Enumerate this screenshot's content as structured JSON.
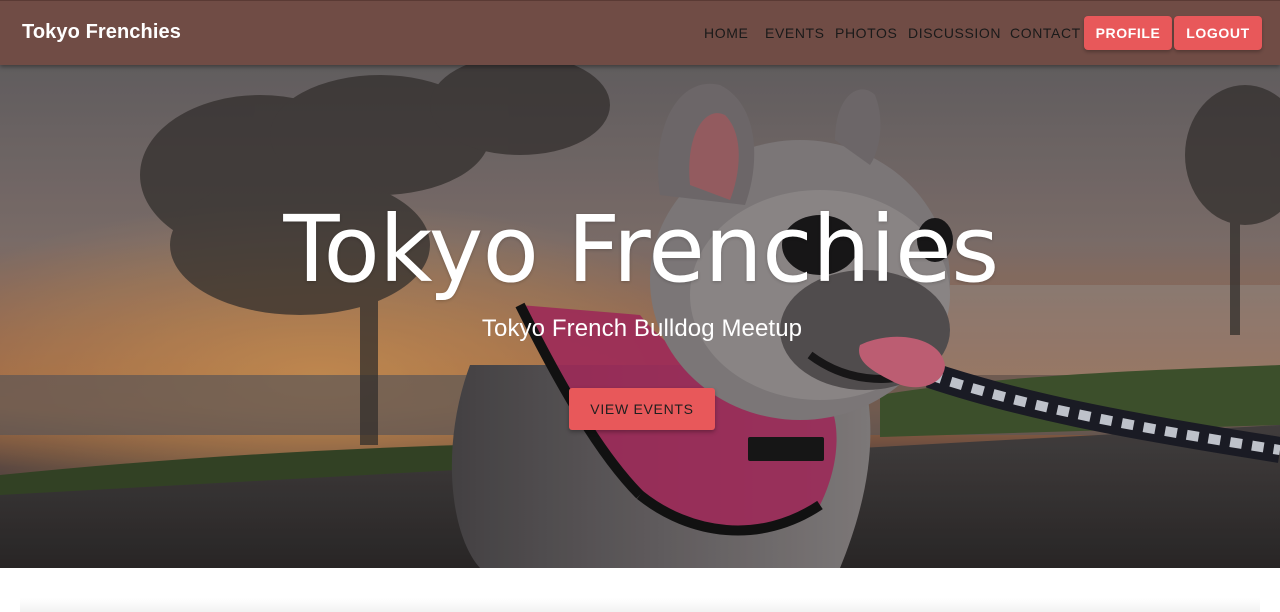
{
  "navbar": {
    "brand": "Tokyo Frenchies",
    "links": [
      "HOME",
      "EVENTS",
      "PHOTOS",
      "DISCUSSION",
      "CONTACT"
    ],
    "profile_label": "PROFILE",
    "logout_label": "LOGOUT"
  },
  "hero": {
    "title": "Tokyo Frenchies",
    "subtitle": "Tokyo French Bulldog Meetup",
    "cta_label": "VIEW EVENTS",
    "background_image": "french-bulldog-sunset-photo"
  },
  "colors": {
    "navbar_bg": "#704c45",
    "accent": "#e8585a",
    "hero_text": "#ffffff"
  }
}
